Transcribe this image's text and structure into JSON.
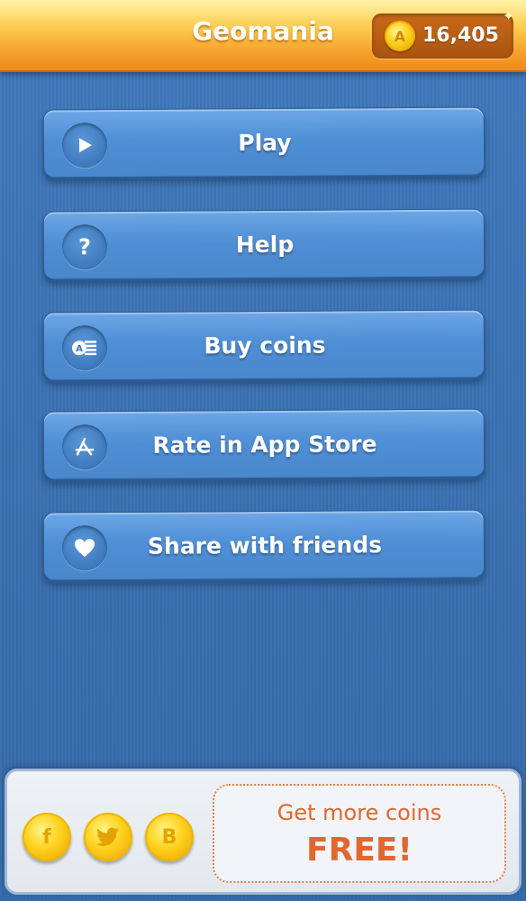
{
  "header": {
    "title": "Geomania",
    "coin_letter": "A",
    "coin_count": "16,405"
  },
  "menu": [
    {
      "label": "Play",
      "icon": "play-icon"
    },
    {
      "label": "Help",
      "icon": "question-icon"
    },
    {
      "label": "Buy coins",
      "icon": "coins-icon"
    },
    {
      "label": "Rate in App Store",
      "icon": "app-store-icon"
    },
    {
      "label": "Share with friends",
      "icon": "heart-icon"
    }
  ],
  "social": [
    {
      "glyph": "f",
      "icon": "facebook-icon"
    },
    {
      "glyph": "🐦",
      "icon": "twitter-icon"
    },
    {
      "glyph": "B",
      "icon": "b-icon"
    }
  ],
  "promo": {
    "line1": "Get more coins",
    "line2": "FREE!"
  },
  "colors": {
    "header_orange": "#f7a12a",
    "button_blue": "#4f8fd6",
    "background_blue": "#3a6fb0",
    "promo_orange": "#e2672e",
    "coin_gold": "#ffd21f"
  }
}
